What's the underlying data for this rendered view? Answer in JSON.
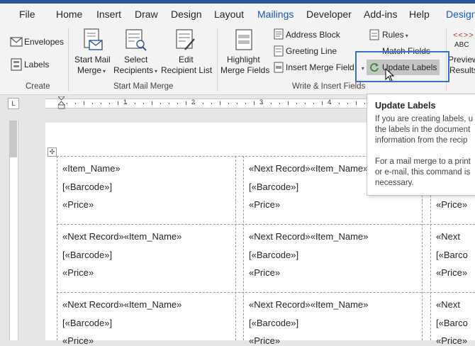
{
  "tabs": [
    "File",
    "Home",
    "Insert",
    "Draw",
    "Design",
    "Layout",
    "Mailings",
    "Developer",
    "Add-ins",
    "Help",
    "Design"
  ],
  "active_tab": "Mailings",
  "accent_color": "#185abd",
  "highlight_color": "#3b6fc6",
  "ribbon": {
    "create": {
      "envelopes": "Envelopes",
      "labels": "Labels",
      "group_label": "Create"
    },
    "start_mail_merge": {
      "start_mail_merge_l1": "Start Mail",
      "start_mail_merge_l2": "Merge",
      "select_recipients_l1": "Select",
      "select_recipients_l2": "Recipients",
      "edit_recipient_list_l1": "Edit",
      "edit_recipient_list_l2": "Recipient List",
      "group_label": "Start Mail Merge"
    },
    "write_insert": {
      "highlight_l1": "Highlight",
      "highlight_l2": "Merge Fields",
      "address_block": "Address Block",
      "greeting_line": "Greeting Line",
      "insert_merge_field": "Insert Merge Field",
      "rules": "Rules",
      "match_fields": "Match Fields",
      "update_labels": "Update Labels",
      "group_label": "Write & Insert Fields"
    },
    "preview": {
      "abc": "ABC",
      "preview_l1": "Preview",
      "preview_l2": "Results"
    }
  },
  "ruler": {
    "tab_selector": "L",
    "numbers": [
      "1",
      "2",
      "3",
      "4"
    ]
  },
  "tooltip": {
    "title": "Update Labels",
    "lines": [
      "If you are creating labels, u",
      "the labels in the document",
      "information from the recip",
      "",
      "For a mail merge to a print",
      "or e-mail, this command is",
      "necessary."
    ]
  },
  "labels": {
    "move_handle": "✣",
    "rows": [
      [
        [
          "«Item_Name»",
          "[«Barcode»]",
          "«Price»"
        ],
        [
          "«Next Record»«Item_Name»",
          "[«Barcode»]",
          "«Price»"
        ],
        [
          "«Price»"
        ]
      ],
      [
        [
          "«Next Record»«Item_Name»",
          "[«Barcode»]",
          "«Price»"
        ],
        [
          "«Next Record»«Item_Name»",
          "[«Barcode»]",
          "«Price»"
        ],
        [
          "«Next",
          "[«Barco",
          "«Price»"
        ]
      ],
      [
        [
          "«Next Record»«Item_Name»",
          "[«Barcode»]",
          "«Price»"
        ],
        [
          "«Next Record»«Item_Name»",
          "[«Barcode»]",
          "«Price»"
        ],
        [
          "«Next",
          "[«Barco",
          "«Price»"
        ]
      ]
    ]
  }
}
